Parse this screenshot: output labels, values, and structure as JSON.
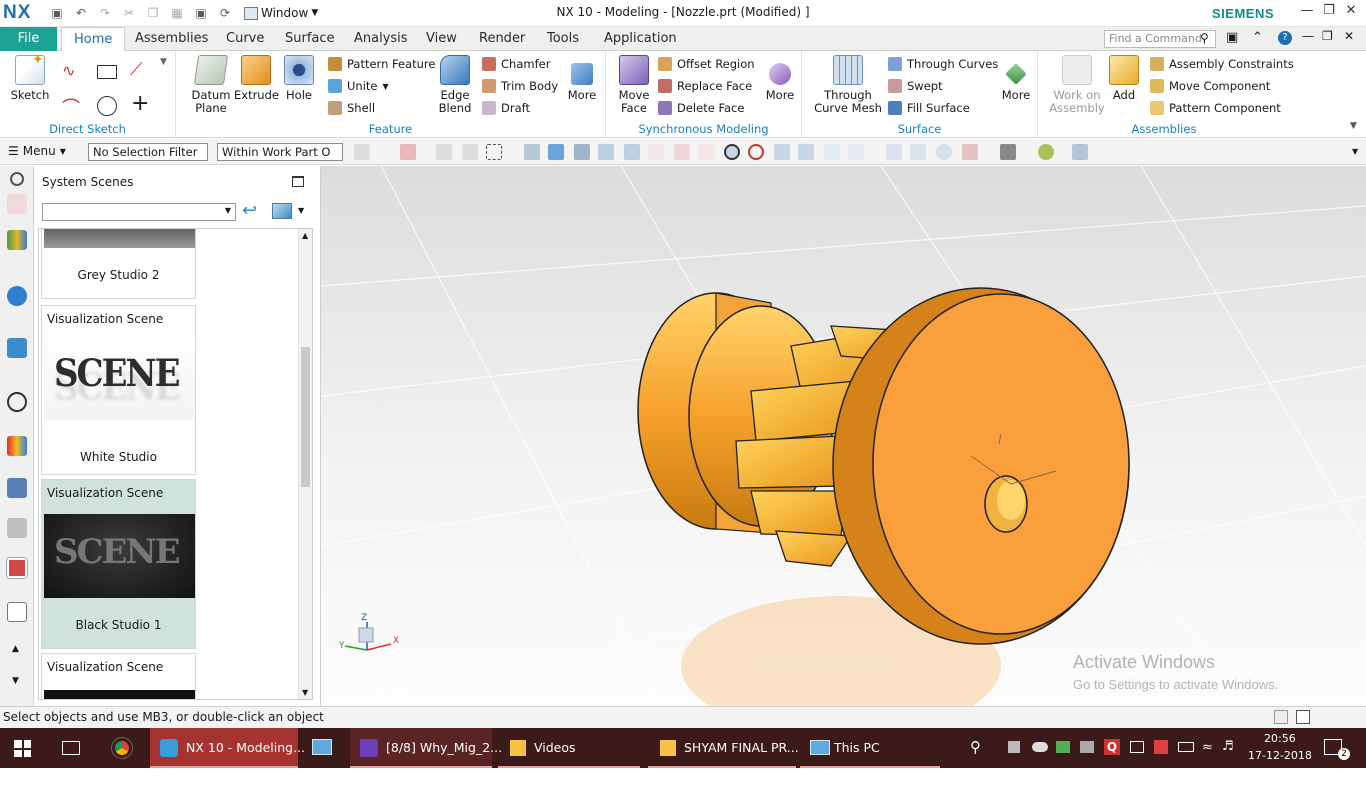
{
  "app": {
    "logo": "NX",
    "window_menu": "Window",
    "title": "NX 10 - Modeling - [Nozzle.prt (Modified) ]",
    "brand": "SIEMENS"
  },
  "tabs": {
    "file": "File",
    "items": [
      "Home",
      "Assemblies",
      "Curve",
      "Surface",
      "Analysis",
      "View",
      "Render",
      "Tools",
      "Application"
    ],
    "active": "Home",
    "find_placeholder": "Find a Command"
  },
  "ribbon": {
    "direct_sketch": {
      "label": "Direct Sketch",
      "sketch": "Sketch"
    },
    "feature": {
      "label": "Feature",
      "datum_plane": "Datum Plane",
      "extrude": "Extrude",
      "hole": "Hole",
      "pattern_feature": "Pattern Feature",
      "unite": "Unite",
      "shell": "Shell",
      "edge_blend": "Edge Blend",
      "chamfer": "Chamfer",
      "trim_body": "Trim Body",
      "draft": "Draft",
      "more": "More"
    },
    "sync": {
      "label": "Synchronous Modeling",
      "move_face": "Move Face",
      "offset_region": "Offset Region",
      "replace_face": "Replace Face",
      "delete_face": "Delete Face",
      "more": "More"
    },
    "surface": {
      "label": "Surface",
      "through_curve_mesh": "Through Curve Mesh",
      "through_curves": "Through Curves",
      "swept": "Swept",
      "fill_surface": "Fill Surface",
      "more": "More"
    },
    "assemblies": {
      "label": "Assemblies",
      "work_on_assembly": "Work on Assembly",
      "add": "Add",
      "assembly_constraints": "Assembly Constraints",
      "move_component": "Move Component",
      "pattern_component": "Pattern Component"
    }
  },
  "toolbar": {
    "menu": "Menu",
    "selection_filter": "No Selection Filter",
    "scope": "Within Work Part O"
  },
  "panel": {
    "title": "System Scenes",
    "scenes": [
      {
        "category": "",
        "name": "Grey Studio 2"
      },
      {
        "category": "Visualization Scene",
        "name": "White Studio"
      },
      {
        "category": "Visualization Scene",
        "name": "Black Studio 1",
        "selected": true
      },
      {
        "category": "Visualization Scene",
        "name": ""
      }
    ]
  },
  "viewport": {
    "triad": {
      "x": "X",
      "y": "Y",
      "z": "Z"
    },
    "watermark_title": "Activate Windows",
    "watermark_sub": "Go to Settings to activate Windows."
  },
  "status": "Select objects and use MB3, or double-click an object",
  "taskbar": {
    "items": [
      "NX 10 - Modeling...",
      "[8/8] Why_Mig_2...",
      "Videos",
      "SHYAM FINAL PR...",
      "This PC"
    ],
    "time": "20:56",
    "date": "17-12-2018",
    "notifications": "2"
  },
  "colors": {
    "accent": "#1b6fb4",
    "file_tab": "#1ca394",
    "part": "#f6a02c",
    "taskbar": "#3d1a1a",
    "selected_scene": "#cfe2db"
  }
}
